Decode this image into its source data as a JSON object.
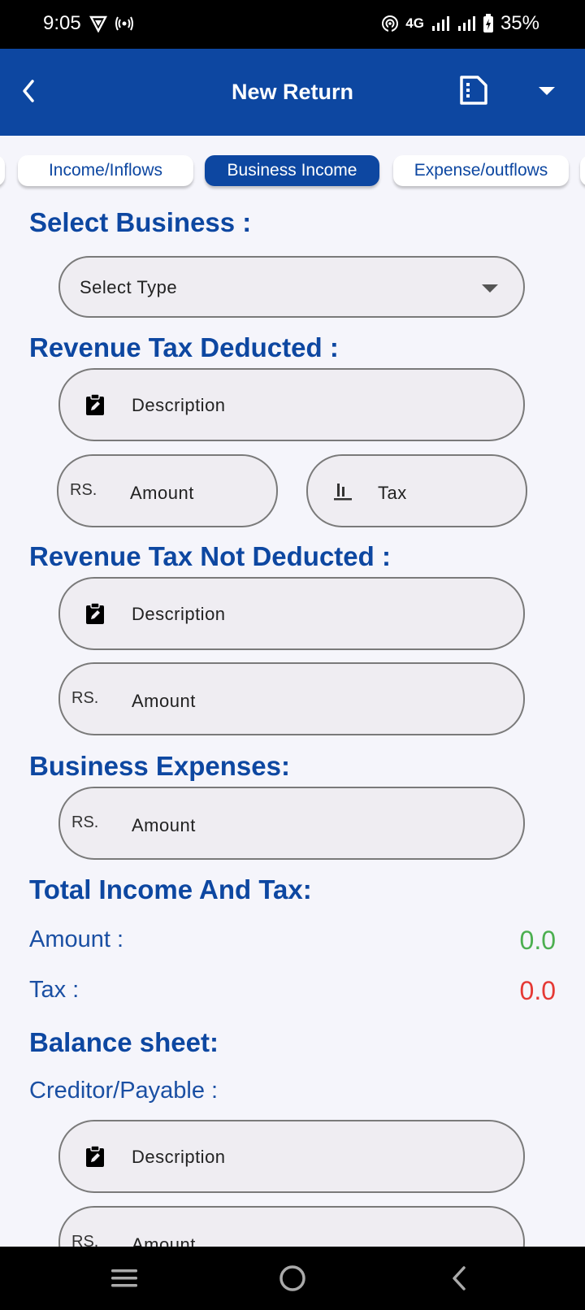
{
  "status": {
    "time": "9:05",
    "network": "4G",
    "battery": "35%"
  },
  "header": {
    "title": "New Return"
  },
  "tabs": [
    {
      "label": "Income/Inflows",
      "active": false
    },
    {
      "label": "Business Income",
      "active": true
    },
    {
      "label": "Expense/outflows",
      "active": false
    }
  ],
  "select_business": {
    "title": "Select Business :",
    "placeholder": "Select Type"
  },
  "tax_deducted": {
    "title": "Revenue Tax Deducted :",
    "description": "Description",
    "currency": "RS.",
    "amount": "Amount",
    "tax": "Tax"
  },
  "tax_not_deducted": {
    "title": "Revenue Tax Not Deducted :",
    "description": "Description",
    "currency": "RS.",
    "amount": "Amount"
  },
  "business_expenses": {
    "title": "Business Expenses:",
    "currency": "RS.",
    "amount": "Amount"
  },
  "totals": {
    "title": "Total Income And Tax:",
    "amount_label": "Amount :",
    "amount_value": "0.0",
    "amount_color": "#4caf50",
    "tax_label": "Tax :",
    "tax_value": "0.0",
    "tax_color": "#e53935"
  },
  "balance_sheet": {
    "title": "Balance sheet:",
    "creditor_label": "Creditor/Payable :",
    "description": "Description",
    "currency": "RS.",
    "amount": "Amount"
  },
  "colors": {
    "primary": "#0d47a1",
    "background": "#f5f5fb"
  }
}
